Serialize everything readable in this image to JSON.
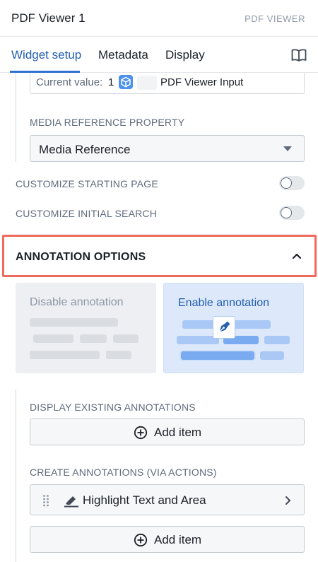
{
  "header": {
    "title": "PDF Viewer 1",
    "type_label": "PDF VIEWER"
  },
  "tabs": [
    {
      "label": "Widget setup",
      "active": true
    },
    {
      "label": "Metadata",
      "active": false
    },
    {
      "label": "Display",
      "active": false
    }
  ],
  "icons": {
    "docs": "book-open-icon",
    "object": "cube-icon",
    "dropdown": "caret-down-icon",
    "collapse": "chevron-up-icon",
    "annotate": "pen-nib-icon",
    "add": "plus-circle-icon",
    "drag": "drag-handle-icon",
    "highlight": "highlighter-icon",
    "open": "chevron-right-icon"
  },
  "current_value": {
    "label": "Current value:",
    "count": "1",
    "name": "PDF Viewer Input"
  },
  "media_reference": {
    "label": "MEDIA REFERENCE PROPERTY",
    "value": "Media Reference"
  },
  "toggles": [
    {
      "label": "CUSTOMIZE STARTING PAGE",
      "on": false
    },
    {
      "label": "CUSTOMIZE INITIAL SEARCH",
      "on": false
    }
  ],
  "annotation_options": {
    "title": "ANNOTATION OPTIONS",
    "expanded": true,
    "cards": [
      {
        "label": "Disable annotation",
        "selected": false
      },
      {
        "label": "Enable annotation",
        "selected": true
      }
    ]
  },
  "display_existing": {
    "label": "DISPLAY EXISTING ANNOTATIONS",
    "add_label": "Add item"
  },
  "create_annotations": {
    "label": "CREATE ANNOTATIONS (VIA ACTIONS)",
    "items": [
      {
        "label": "Highlight Text and Area"
      }
    ],
    "add_label": "Add item"
  },
  "colors": {
    "accent": "#2d72d2",
    "highlight_border": "#ee6a5d",
    "selected_card": "#dde9fb",
    "unselected_card": "#edeff2"
  }
}
